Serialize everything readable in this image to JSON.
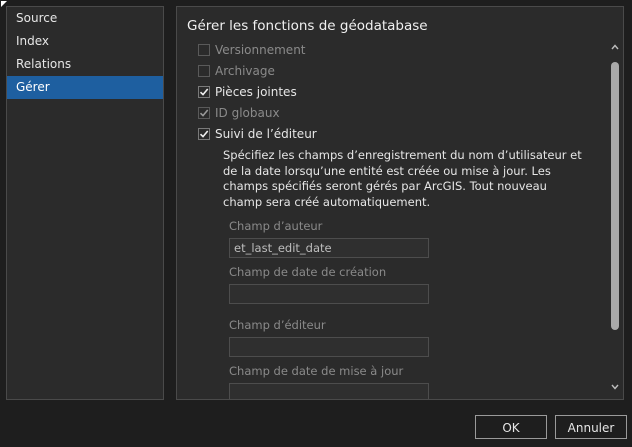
{
  "sidebar": {
    "items": [
      {
        "label": "Source",
        "selected": false
      },
      {
        "label": "Index",
        "selected": false
      },
      {
        "label": "Relations",
        "selected": false
      },
      {
        "label": "Gérer",
        "selected": true
      }
    ]
  },
  "panel": {
    "title": "Gérer les fonctions de géodatabase",
    "checkboxes": [
      {
        "label": "Versionnement",
        "checked": false,
        "enabled": false
      },
      {
        "label": "Archivage",
        "checked": false,
        "enabled": false
      },
      {
        "label": "Pièces jointes",
        "checked": true,
        "enabled": true
      },
      {
        "label": "ID globaux",
        "checked": true,
        "enabled": false
      },
      {
        "label": "Suivi de l’éditeur",
        "checked": true,
        "enabled": true
      }
    ],
    "description": "Spécifiez les champs d’enregistrement du nom d’utilisateur et de la date lorsqu’une entité est créée ou mise à jour. Les champs spécifiés seront gérés par ArcGIS. Tout nouveau champ sera créé automatiquement.",
    "fields": [
      {
        "label": "Champ d’auteur",
        "value": "et_last_edit_date"
      },
      {
        "label": "Champ de date de création",
        "value": ""
      },
      {
        "label": "Champ d’éditeur",
        "value": ""
      },
      {
        "label": "Champ de date de mise à jour",
        "value": ""
      }
    ]
  },
  "buttons": {
    "ok": "OK",
    "cancel": "Annuler"
  },
  "colors": {
    "selection": "#1e5fa0",
    "background": "#1e1e1e",
    "panel": "#2b2b2b"
  }
}
